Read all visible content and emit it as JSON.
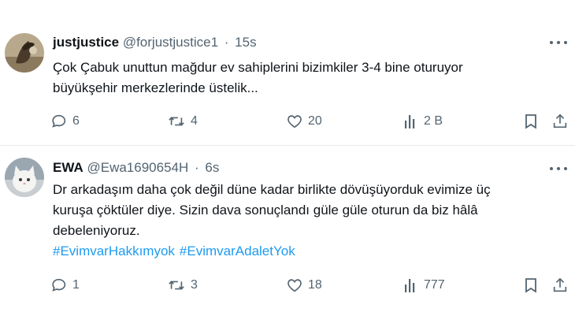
{
  "tweets": [
    {
      "name": "justjustice",
      "handle": "@forjustjustice1",
      "separator": "·",
      "time": "15s",
      "text_lines": [
        "Çok Çabuk unuttun mağdur ev sahiplerini bizimkiler 3-4 bine oturuyor",
        "büyükşehir merkezlerinde üstelik..."
      ],
      "hashtags": [],
      "replies": "6",
      "retweets": "4",
      "likes": "20",
      "views": "2 B"
    },
    {
      "name": "EWA",
      "handle": "@Ewa1690654H",
      "separator": "·",
      "time": "6s",
      "text_lines": [
        "Dr arkadaşım daha çok değil düne kadar birlikte dövüşüyorduk evimize üç",
        "kuruşa çöktüler diye. Sizin dava sonuçlandı güle güle oturun da biz hâlâ",
        "debeleniyoruz."
      ],
      "hashtags": [
        "#EvimvarHakkımyok",
        "#EvimvarAdaletYok"
      ],
      "replies": "1",
      "retweets": "3",
      "likes": "18",
      "views": "777"
    }
  ],
  "icons": {
    "reply": "reply-bubble-icon",
    "retweet": "retweet-icon",
    "like": "heart-icon",
    "views": "views-bar-chart-icon",
    "bookmark": "bookmark-icon",
    "share": "share-upload-icon",
    "more": "more-dots-icon"
  },
  "colors": {
    "text": "#0f1419",
    "secondary": "#536471",
    "link": "#1d9bf0",
    "divider": "#e6e9eb"
  }
}
